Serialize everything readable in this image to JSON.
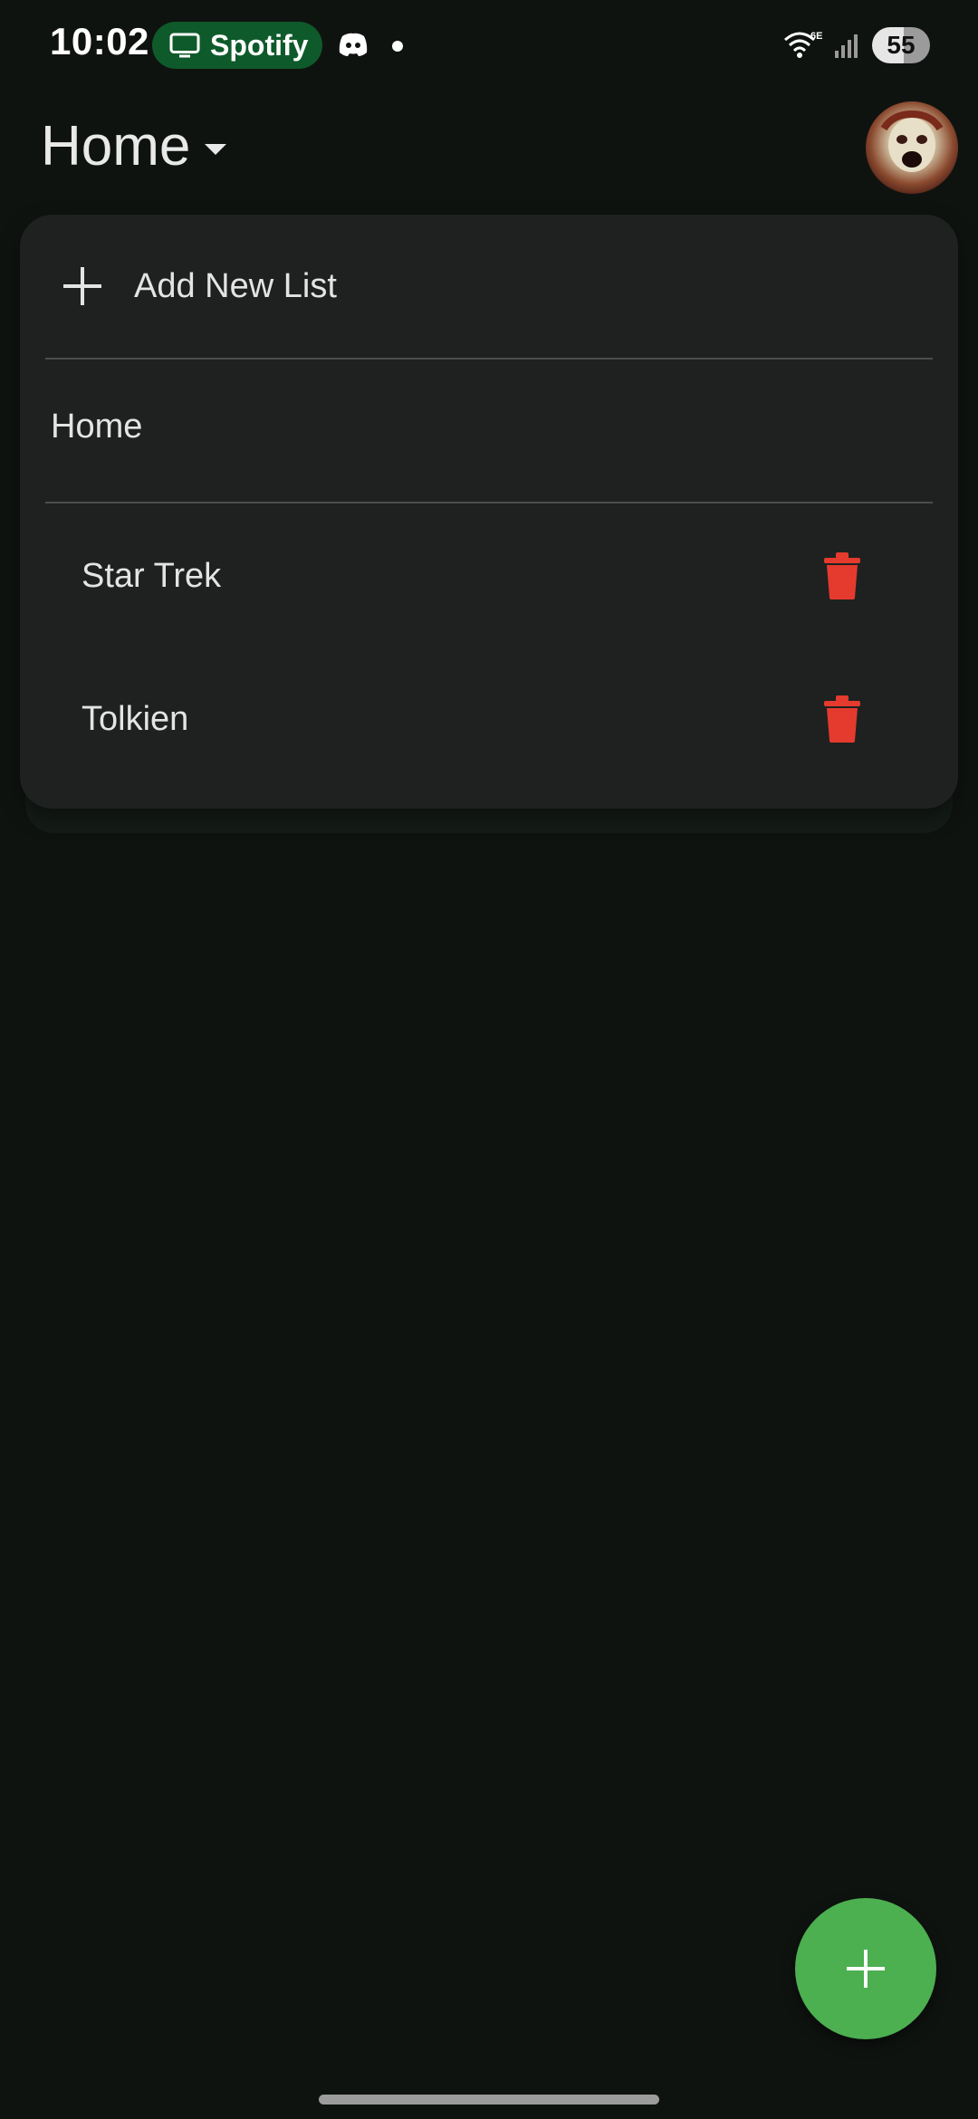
{
  "status_bar": {
    "time": "10:02",
    "media_app": "Spotify",
    "battery": "55",
    "network": "6E",
    "icons": [
      "cast-icon",
      "discord-icon",
      "wifi-icon",
      "signal-icon",
      "battery-icon"
    ]
  },
  "header": {
    "title": "Home",
    "avatar_icon": "profile-avatar"
  },
  "menu": {
    "add_label": "Add New List",
    "section_label": "Home",
    "items": [
      {
        "label": "Star Trek",
        "action_icon": "trash-icon"
      },
      {
        "label": "Tolkien",
        "action_icon": "trash-icon"
      }
    ]
  },
  "fab": {
    "icon": "plus-icon"
  },
  "colors": {
    "background": "#0f1310",
    "card": "#1e211f",
    "accent": "#4caf50",
    "danger": "#e53a2e",
    "spotify_pill": "#0f5a2a"
  }
}
